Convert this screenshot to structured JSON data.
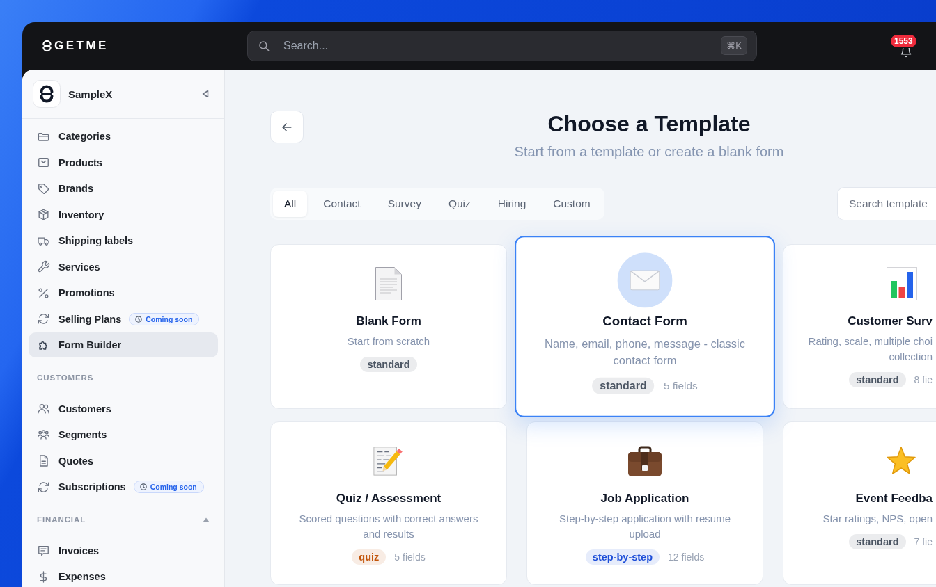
{
  "topbar": {
    "logo": "GETME",
    "search": {
      "placeholder": "Search...",
      "shortcut": "⌘K"
    },
    "notifications": {
      "count": "1553"
    }
  },
  "sidebar": {
    "workspace": "SampleX",
    "sections": [
      {
        "items": [
          {
            "label": "Categories",
            "selected": false
          },
          {
            "label": "Products",
            "selected": false
          },
          {
            "label": "Brands",
            "selected": false
          },
          {
            "label": "Inventory",
            "selected": false
          },
          {
            "label": "Shipping labels",
            "selected": false
          },
          {
            "label": "Services",
            "selected": false
          },
          {
            "label": "Promotions",
            "selected": false
          },
          {
            "label": "Selling Plans",
            "selected": false,
            "badge": "Coming soon"
          },
          {
            "label": "Form Builder",
            "selected": true
          }
        ]
      },
      {
        "title": "CUSTOMERS",
        "items": [
          {
            "label": "Customers",
            "selected": false
          },
          {
            "label": "Segments",
            "selected": false
          },
          {
            "label": "Quotes",
            "selected": false
          },
          {
            "label": "Subscriptions",
            "selected": false,
            "badge": "Coming soon"
          }
        ]
      },
      {
        "title": "FINANCIAL",
        "expanded": true,
        "items": [
          {
            "label": "Invoices",
            "selected": false
          },
          {
            "label": "Expenses",
            "selected": false
          }
        ]
      }
    ]
  },
  "main": {
    "heading": {
      "title": "Choose a Template",
      "subtitle": "Start from a template or create a blank form"
    },
    "filters": {
      "tabs": [
        {
          "label": "All",
          "selected": true
        },
        {
          "label": "Contact",
          "selected": false
        },
        {
          "label": "Survey",
          "selected": false
        },
        {
          "label": "Quiz",
          "selected": false
        },
        {
          "label": "Hiring",
          "selected": false
        },
        {
          "label": "Custom",
          "selected": false
        }
      ],
      "search": {
        "placeholder": "Search template"
      }
    },
    "templates": [
      {
        "title": "Blank Form",
        "description": "Start from scratch",
        "tag": {
          "label": "standard",
          "color": "#4b5563"
        },
        "selected": false
      },
      {
        "title": "Contact Form",
        "description": "Name, email, phone, message - classic contact form",
        "tag": {
          "label": "standard",
          "color": "#4b5563"
        },
        "fields": "5 fields",
        "selected": true
      },
      {
        "title": "Customer Surv",
        "description": "Rating, scale, multiple choi\ncollection",
        "tag": {
          "label": "standard",
          "color": "#4b5563"
        },
        "fields": "8 fie",
        "selected": false
      },
      {
        "title": "Quiz / Assessment",
        "description": "Scored questions with correct answers and results",
        "tag": {
          "label": "quiz",
          "color": "#c2540a"
        },
        "fields": "5 fields",
        "selected": false
      },
      {
        "title": "Job Application",
        "description": "Step-by-step application with resume upload",
        "tag": {
          "label": "step-by-step",
          "color": "#1d4ed8"
        },
        "fields": "12 fields",
        "selected": false
      },
      {
        "title": "Event Feedba",
        "description": "Star ratings, NPS, open",
        "tag": {
          "label": "standard",
          "color": "#4b5563"
        },
        "fields": "7 fie",
        "selected": false
      }
    ]
  }
}
